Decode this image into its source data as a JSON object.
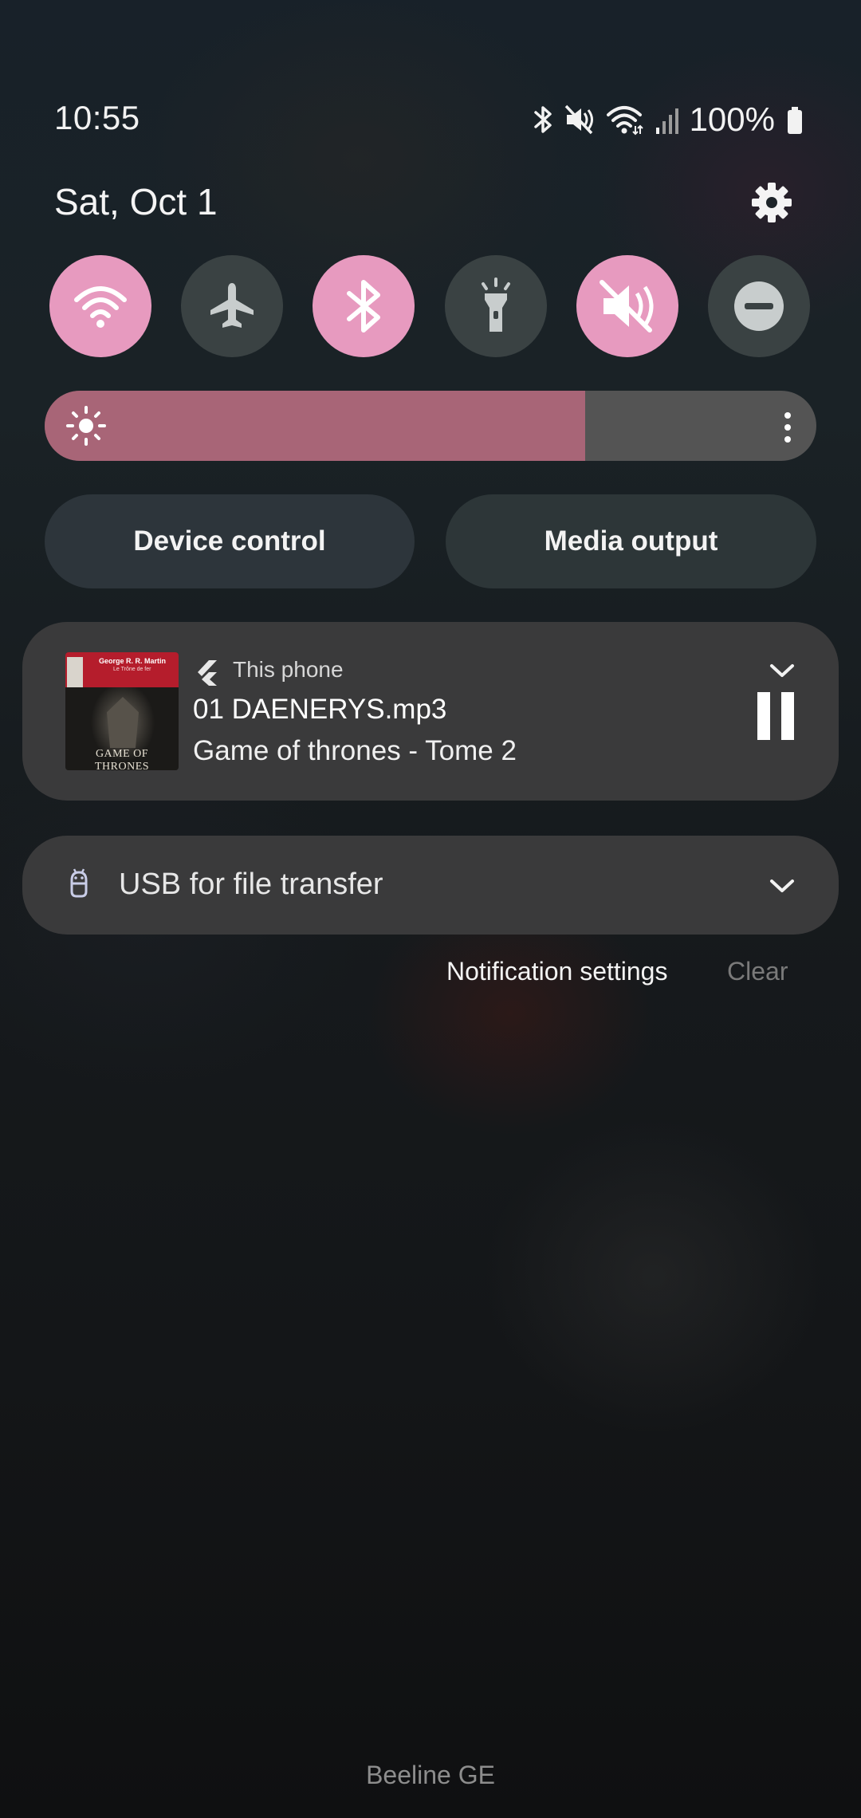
{
  "status_bar": {
    "time": "10:55",
    "battery": "100%",
    "icons": [
      "bluetooth-icon",
      "mute-icon",
      "wifi-icon",
      "signal-icon",
      "battery-icon"
    ]
  },
  "header": {
    "date": "Sat, Oct 1",
    "settings_icon": "gear-icon"
  },
  "quick_toggles": [
    {
      "name": "wifi",
      "icon": "wifi-icon",
      "state": "on"
    },
    {
      "name": "airplane-mode",
      "icon": "airplane-icon",
      "state": "off"
    },
    {
      "name": "bluetooth",
      "icon": "bluetooth-icon",
      "state": "on"
    },
    {
      "name": "flashlight",
      "icon": "flashlight-icon",
      "state": "off"
    },
    {
      "name": "mute",
      "icon": "mute-icon",
      "state": "on"
    },
    {
      "name": "do-not-disturb",
      "icon": "do-not-disturb-icon",
      "state": "off"
    }
  ],
  "brightness": {
    "level": 0.7,
    "icon": "sun-icon"
  },
  "buttons": {
    "device_control": "Device control",
    "media_output": "Media output"
  },
  "media": {
    "source": "This phone",
    "title": "01 DAENERYS.mp3",
    "artist": "Game of thrones - Tome 2",
    "album_art": {
      "author": "George R. R. Martin",
      "subtitle": "Le Trône de fer",
      "title": "GAME OF THRONES"
    }
  },
  "usb": {
    "label": "USB for file transfer"
  },
  "notification_actions": {
    "settings": "Notification settings",
    "clear": "Clear"
  },
  "carrier": "Beeline GE",
  "colors": {
    "toggle_on": "#e79abf",
    "toggle_off": "#3a4243",
    "brightness_fill": "#a86577",
    "card_bg": "#3a3a3b"
  }
}
